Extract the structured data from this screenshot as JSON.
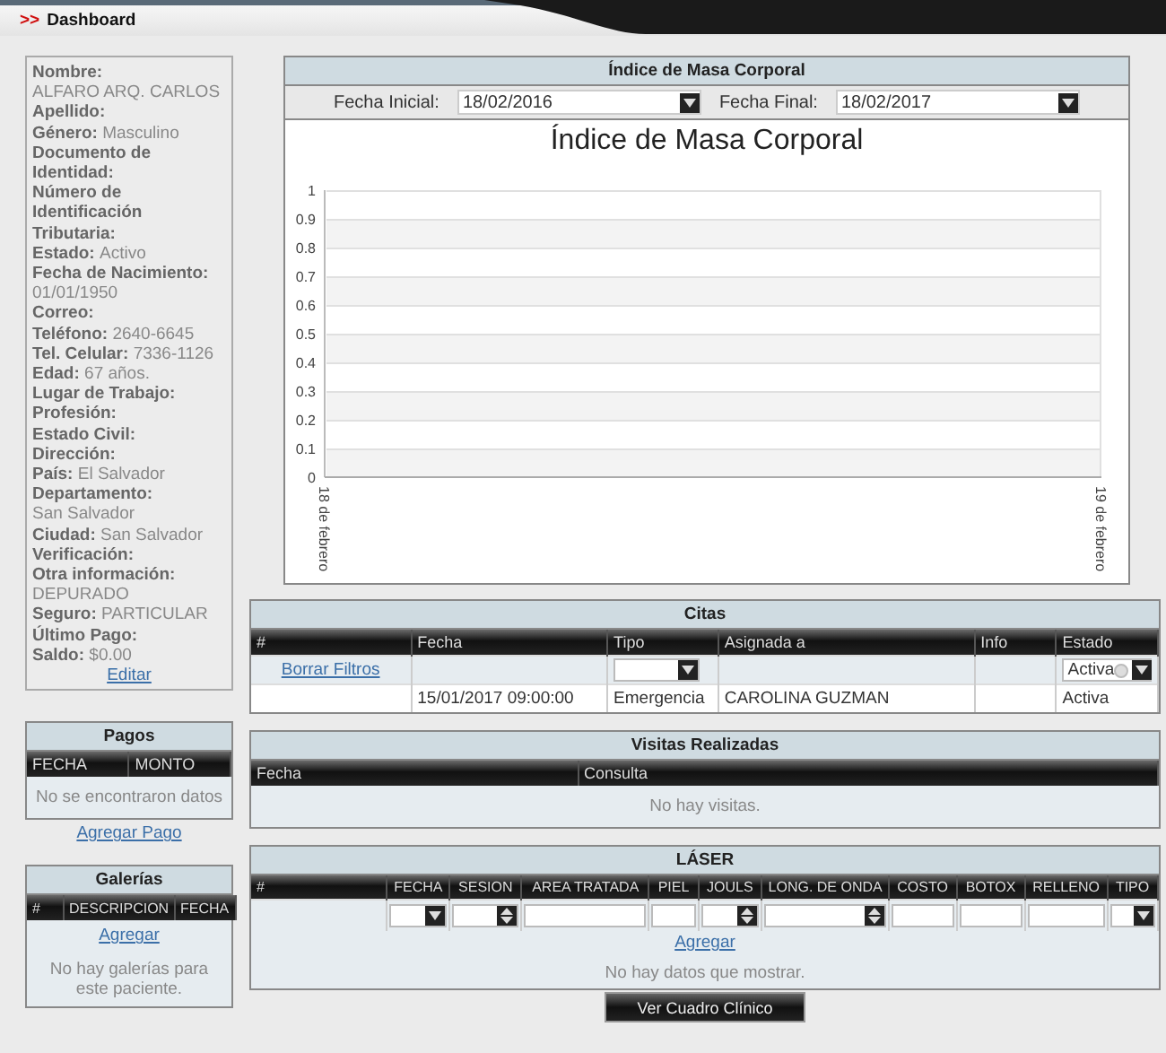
{
  "breadcrumb": {
    "marker": ">>",
    "title": "Dashboard"
  },
  "profile": {
    "fields": [
      {
        "label": "Nombre:",
        "value": "ALFARO ARQ. CARLOS"
      },
      {
        "label": "Apellido:"
      },
      {
        "label": "Género:",
        "value": "Masculino"
      },
      {
        "label": "Documento de Identidad:"
      },
      {
        "label": "Número de Identificación Tributaria:"
      },
      {
        "label": "Estado:",
        "value": "Activo"
      },
      {
        "label": "Fecha de Nacimiento:",
        "value": "01/01/1950"
      },
      {
        "label": "Correo:"
      },
      {
        "label": "Teléfono:",
        "value": "2640-6645"
      },
      {
        "label": "Tel. Celular:",
        "value": "7336-1126"
      },
      {
        "label": "Edad:",
        "value": "67 años."
      },
      {
        "label": "Lugar de Trabajo:"
      },
      {
        "label": "Profesión:"
      },
      {
        "label": "Estado Civil:"
      },
      {
        "label": "Dirección:"
      },
      {
        "label": "País:",
        "value": "El Salvador"
      },
      {
        "label": "Departamento:",
        "value": "San Salvador"
      },
      {
        "label": "Ciudad:",
        "value": "San Salvador"
      },
      {
        "label": "Verificación:"
      },
      {
        "label": "Otra información:",
        "value": "DEPURADO"
      },
      {
        "label": "Seguro:",
        "value": "PARTICULAR"
      },
      {
        "label": "Último Pago:"
      },
      {
        "label": "Saldo:",
        "value": "$0.00"
      }
    ],
    "edit_link": "Editar"
  },
  "pagos": {
    "title": "Pagos",
    "columns": [
      "FECHA",
      "MONTO"
    ],
    "empty": "No se encontraron datos",
    "add_link": "Agregar Pago"
  },
  "galerias": {
    "title": "Galerías",
    "columns": [
      "#",
      "DESCRIPCION",
      "FECHA"
    ],
    "add_link": "Agregar",
    "empty": "No hay galerías para este paciente."
  },
  "imc": {
    "title": "Índice de Masa Corporal",
    "start_label": "Fecha Inicial:",
    "start_value": "18/02/2016",
    "end_label": "Fecha Final:",
    "end_value": "18/02/2017",
    "chart_data": {
      "type": "line",
      "title": "Índice de Masa Corporal",
      "categories": [
        "18 de febrero",
        "19 de febrero"
      ],
      "ylim": [
        0,
        1
      ],
      "yticks": [
        0,
        0.1,
        0.2,
        0.3,
        0.4,
        0.5,
        0.6,
        0.7,
        0.8,
        0.9,
        1
      ]
    }
  },
  "citas": {
    "title": "Citas",
    "columns": [
      "#",
      "Fecha",
      "Tipo",
      "Asignada a",
      "Info",
      "Estado"
    ],
    "clear_filters": "Borrar Filtros",
    "estado_filter": "Activa",
    "rows": [
      {
        "cells": [
          "",
          "15/01/2017 09:00:00",
          "Emergencia",
          "CAROLINA GUZMAN",
          "",
          "Activa"
        ]
      }
    ]
  },
  "visitas": {
    "title": "Visitas Realizadas",
    "columns": [
      "Fecha",
      "Consulta"
    ],
    "empty": "No hay visitas."
  },
  "laser": {
    "title": "LÁSER",
    "columns": [
      {
        "label": "#",
        "kind": "none"
      },
      {
        "label": "FECHA",
        "kind": "select"
      },
      {
        "label": "SESION",
        "kind": "spinner"
      },
      {
        "label": "AREA TRATADA",
        "kind": "text"
      },
      {
        "label": "PIEL",
        "kind": "text"
      },
      {
        "label": "JOULS",
        "kind": "spinner"
      },
      {
        "label": "LONG. DE ONDA",
        "kind": "spinner"
      },
      {
        "label": "COSTO",
        "kind": "text"
      },
      {
        "label": "BOTOX",
        "kind": "text"
      },
      {
        "label": "RELLENO",
        "kind": "text"
      },
      {
        "label": "TIPO",
        "kind": "select"
      }
    ],
    "add_link": "Agregar",
    "empty": "No hay datos que mostrar."
  },
  "footer_button": "Ver Cuadro Clínico"
}
